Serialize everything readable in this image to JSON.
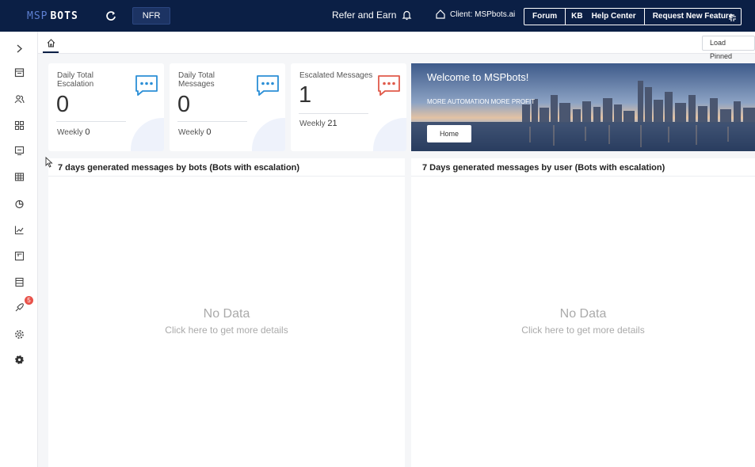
{
  "topbar": {
    "logo_prefix": "MSP",
    "logo_suffix": "BOTS",
    "nfr_label": "NFR",
    "refer_label": "Refer and Earn",
    "client_label": "Client: MSPbots.ai",
    "links": [
      "Forum",
      "KB",
      "Help Center",
      "Request New Feature"
    ]
  },
  "sidebar": {
    "items": [
      "chevron-right-icon",
      "calendar-icon",
      "people-icon",
      "apps-icon",
      "monitor-icon",
      "grid-icon",
      "pie-chart-icon",
      "line-chart-icon",
      "board-icon",
      "report-icon",
      "rocket-icon",
      "settings-icon",
      "admin-gear-icon"
    ],
    "badge_count": "5"
  },
  "toolbar": {
    "load_pinned_label": "Load Pinned"
  },
  "cards": [
    {
      "label": "Daily Total Escalation",
      "value": "0",
      "weekly_label": "Weekly",
      "weekly_value": "0",
      "icon_color": "#2b8fd6"
    },
    {
      "label": "Daily Total Messages",
      "value": "0",
      "weekly_label": "Weekly",
      "weekly_value": "0",
      "icon_color": "#2b8fd6"
    },
    {
      "label": "Escalated Messages",
      "value": "1",
      "weekly_label": "Weekly",
      "weekly_value": "21",
      "icon_color": "#e05a4a"
    }
  ],
  "banner": {
    "title": "Welcome to MSPbots!",
    "tagline": "MORE AUTOMATION MORE PROFIT",
    "button_label": "Home"
  },
  "panels": [
    {
      "title": "7 days generated messages by bots (Bots with escalation)",
      "empty_title": "No Data",
      "empty_hint": "Click here to get more details"
    },
    {
      "title": "7 Days generated messages by user (Bots with escalation)",
      "empty_title": "No Data",
      "empty_hint": "Click here to get more details"
    }
  ],
  "colors": {
    "topbar_bg": "#0b1f45",
    "accent_blue": "#2b8fd6",
    "accent_red": "#e05a4a",
    "badge_red": "#e8524a"
  }
}
